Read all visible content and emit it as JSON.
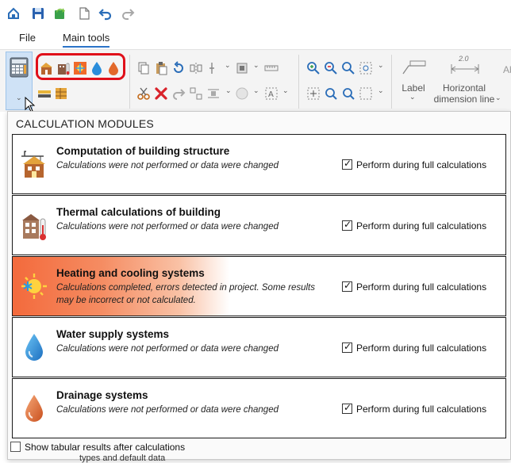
{
  "menu": {
    "tabs": [
      {
        "label": "File"
      },
      {
        "label": "Main tools",
        "active": true
      }
    ]
  },
  "ribbon": {
    "label_button": "Label",
    "hdim_value": "2.0",
    "hdim_line1": "Horizontal",
    "hdim_line2": "dimension line",
    "cut_label": "Ab"
  },
  "panel": {
    "title": "CALCULATION MODULES",
    "modules": [
      {
        "title": "Computation of building structure",
        "status": "Calculations were not performed or data were changed",
        "perform_label": "Perform during full calculations",
        "perform_checked": true,
        "icon": "building-structure-icon"
      },
      {
        "title": "Thermal calculations of building",
        "status": "Calculations were not performed or data were changed",
        "perform_label": "Perform during full calculations",
        "perform_checked": true,
        "icon": "thermal-building-icon"
      },
      {
        "title": "Heating and cooling systems",
        "status": "Calculations completed, errors detected in project. Some results may be incorrect or not calculated.",
        "perform_label": "Perform during full calculations",
        "perform_checked": true,
        "state": "error",
        "icon": "sun-snowflake-icon"
      },
      {
        "title": "Water supply systems",
        "status": "Calculations were not performed or data were changed",
        "perform_label": "Perform during full calculations",
        "perform_checked": true,
        "icon": "water-drop-icon"
      },
      {
        "title": "Drainage systems",
        "status": "Calculations were not performed or data were changed",
        "perform_label": "Perform during full calculations",
        "perform_checked": true,
        "icon": "drainage-drop-icon"
      }
    ],
    "footer_checkbox_label": "Show tabular results after calculations",
    "footer_checked": false
  },
  "below_text": "types and default data",
  "colors": {
    "accent": "#2b73c8",
    "error_gradient": "#f36a3c",
    "highlight": "#e0101a"
  }
}
